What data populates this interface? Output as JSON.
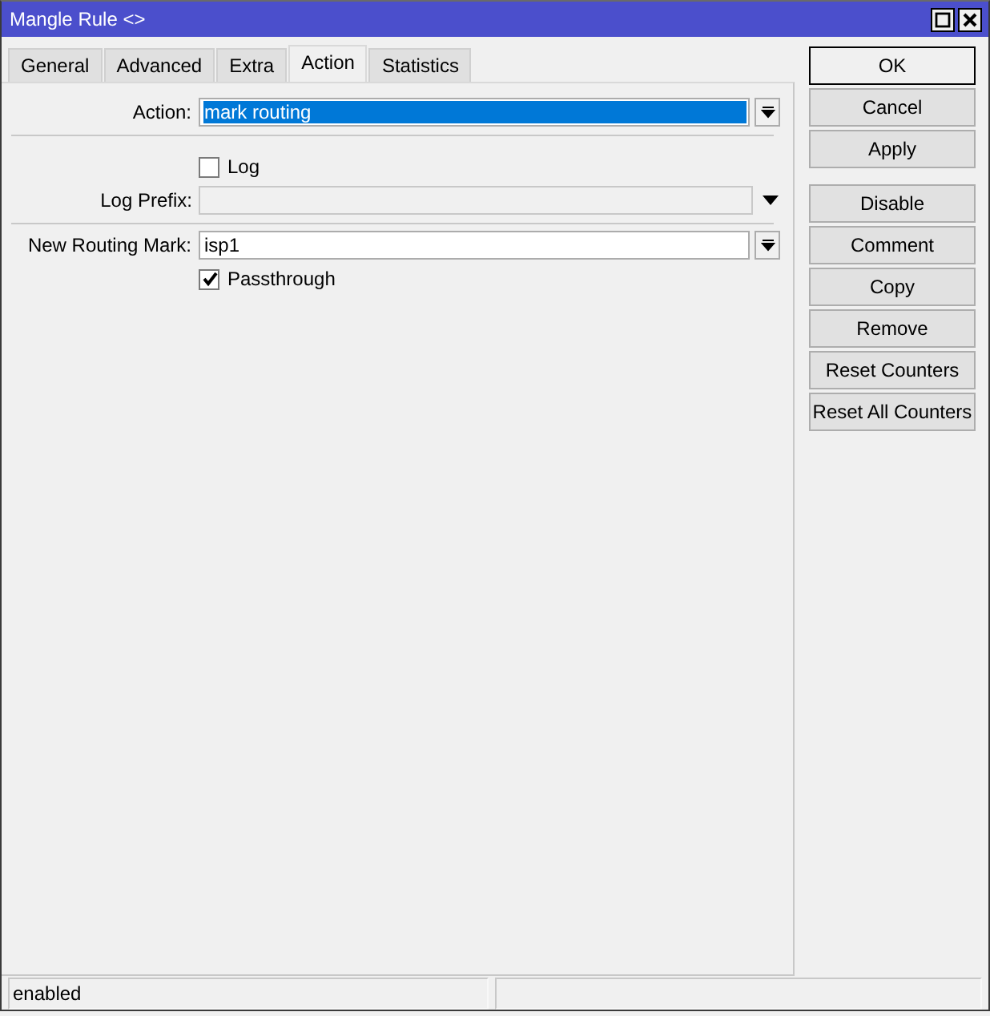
{
  "window": {
    "title": "Mangle Rule <>"
  },
  "tabs": [
    {
      "label": "General",
      "selected": false
    },
    {
      "label": "Advanced",
      "selected": false
    },
    {
      "label": "Extra",
      "selected": false
    },
    {
      "label": "Action",
      "selected": true
    },
    {
      "label": "Statistics",
      "selected": false
    }
  ],
  "sections": [
    [
      {
        "kind": "combo",
        "label": "Action:",
        "value": "mark routing",
        "selected": true
      }
    ],
    [
      {
        "kind": "checkbox",
        "label": "Log",
        "checked": false
      },
      {
        "kind": "dropdown",
        "label": "Log Prefix:",
        "disabled": true
      }
    ],
    [
      {
        "kind": "combo",
        "label": "New Routing Mark:",
        "value": "isp1",
        "selected": false
      },
      {
        "kind": "checkbox",
        "label": "Passthrough",
        "checked": true
      }
    ]
  ],
  "dialog_buttons": [
    {
      "label": "OK",
      "default": true
    },
    {
      "label": "Cancel",
      "default": false
    },
    {
      "label": "Apply",
      "default": false
    }
  ],
  "action_buttons": [
    {
      "label": "Disable",
      "default": false
    },
    {
      "label": "Comment",
      "default": false
    },
    {
      "label": "Copy",
      "default": false
    },
    {
      "label": "Remove",
      "default": false
    },
    {
      "label": "Reset Counters",
      "default": false
    },
    {
      "label": "Reset All Counters",
      "default": false
    }
  ],
  "status_bar": {
    "status": "enabled"
  }
}
